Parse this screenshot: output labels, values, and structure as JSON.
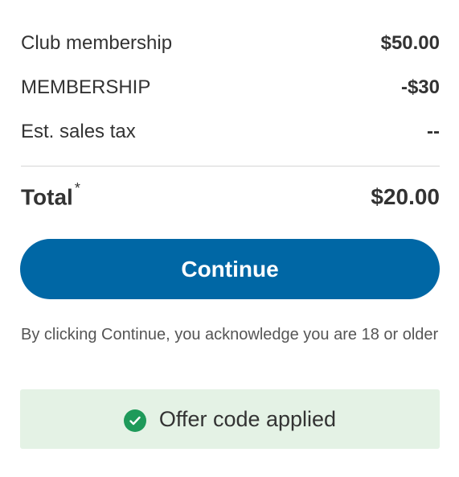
{
  "order_summary": {
    "items": [
      {
        "label": "Club membership",
        "value": "$50.00"
      },
      {
        "label": "MEMBERSHIP",
        "value": "-$30"
      },
      {
        "label": "Est. sales tax",
        "value": "--"
      }
    ],
    "total": {
      "label": "Total",
      "footnote_marker": "*",
      "value": "$20.00"
    }
  },
  "continue_button": {
    "label": "Continue",
    "color": "#0067a5"
  },
  "acknowledgement": "By clicking Continue, you acknowledge you are 18 or older",
  "offer": {
    "icon": "check-circle-icon",
    "text": "Offer code applied",
    "background_color": "#e4f2e5",
    "icon_color": "#1e9a5a"
  }
}
